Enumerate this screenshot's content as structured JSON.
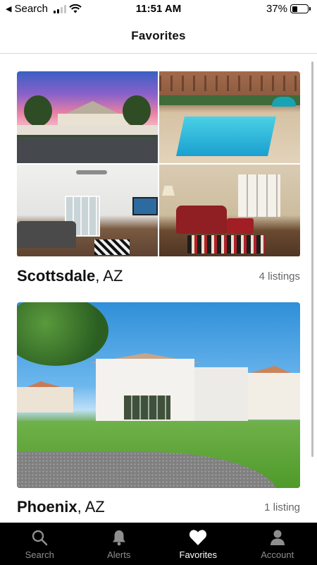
{
  "status_bar": {
    "back_label": "Search",
    "time": "11:51 AM",
    "battery": "37%",
    "battery_level": 0.37
  },
  "nav": {
    "title": "Favorites"
  },
  "favorites": [
    {
      "city": "Scottsdale",
      "state": ", AZ",
      "count": "4 listings"
    },
    {
      "city": "Phoenix",
      "state": ", AZ",
      "count": "1 listing"
    }
  ],
  "tabs": [
    {
      "label": "Search",
      "icon": "magnifier-icon",
      "active": false
    },
    {
      "label": "Alerts",
      "icon": "bell-icon",
      "active": false
    },
    {
      "label": "Favorites",
      "icon": "heart-icon",
      "active": true
    },
    {
      "label": "Account",
      "icon": "person-icon",
      "active": false
    }
  ],
  "colors": {
    "tab_bar_bg": "#000000",
    "tab_active": "#ffffff",
    "tab_inactive": "#8e8e8e",
    "secondary_text": "#666666"
  }
}
